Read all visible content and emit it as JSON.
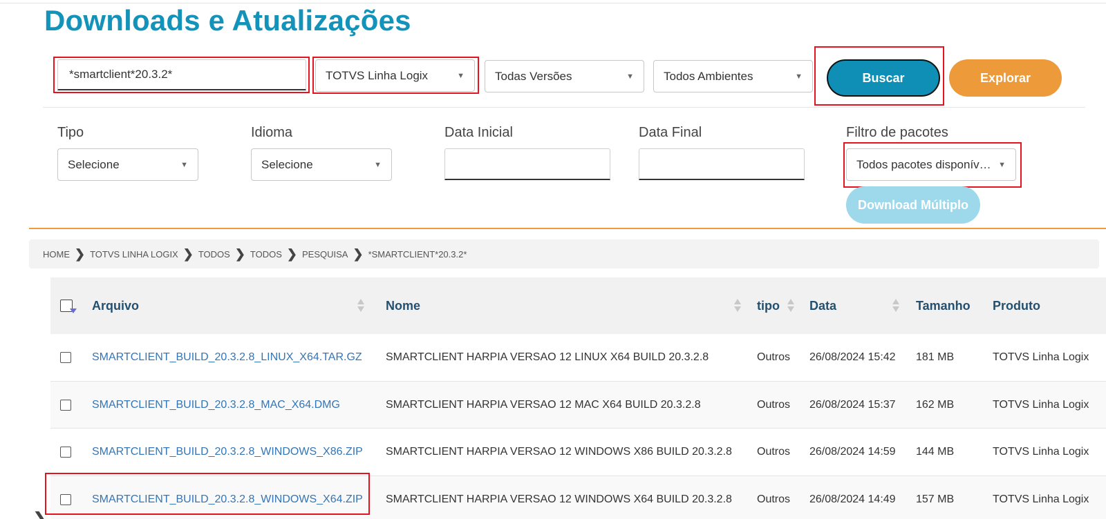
{
  "page_title": "Downloads e Atualizações",
  "search": {
    "query": "*smartclient*20.3.2*",
    "line": "TOTVS Linha Logix",
    "version": "Todas Versões",
    "environment": "Todos Ambientes",
    "buscar_label": "Buscar",
    "explorar_label": "Explorar"
  },
  "filters": {
    "tipo_label": "Tipo",
    "tipo_value": "Selecione",
    "idioma_label": "Idioma",
    "idioma_value": "Selecione",
    "data_inicial_label": "Data Inicial",
    "data_final_label": "Data Final",
    "pacotes_label": "Filtro de pacotes",
    "pacotes_value": "Todos pacotes disponíveis",
    "download_multiplo_label": "Download Múltiplo"
  },
  "breadcrumb": [
    "HOME",
    "TOTVS LINHA LOGIX",
    "TODOS",
    "TODOS",
    "PESQUISA",
    "*SMARTCLIENT*20.3.2*"
  ],
  "table": {
    "columns": [
      "Arquivo",
      "Nome",
      "tipo",
      "Data",
      "Tamanho",
      "Produto"
    ],
    "rows": [
      {
        "arquivo": "SMARTCLIENT_BUILD_20.3.2.8_LINUX_X64.TAR.GZ",
        "nome": "SMARTCLIENT HARPIA VERSAO 12 LINUX X64 BUILD 20.3.2.8",
        "tipo": "Outros",
        "data": "26/08/2024 15:42",
        "tamanho": "181 MB",
        "produto": "TOTVS Linha Logix"
      },
      {
        "arquivo": "SMARTCLIENT_BUILD_20.3.2.8_MAC_X64.DMG",
        "nome": "SMARTCLIENT HARPIA VERSAO 12 MAC X64 BUILD 20.3.2.8",
        "tipo": "Outros",
        "data": "26/08/2024 15:37",
        "tamanho": "162 MB",
        "produto": "TOTVS Linha Logix"
      },
      {
        "arquivo": "SMARTCLIENT_BUILD_20.3.2.8_WINDOWS_X86.ZIP",
        "nome": "SMARTCLIENT HARPIA VERSAO 12 WINDOWS X86 BUILD 20.3.2.8",
        "tipo": "Outros",
        "data": "26/08/2024 14:59",
        "tamanho": "144 MB",
        "produto": "TOTVS Linha Logix"
      },
      {
        "arquivo": "SMARTCLIENT_BUILD_20.3.2.8_WINDOWS_X64.ZIP",
        "nome": "SMARTCLIENT HARPIA VERSAO 12 WINDOWS X64 BUILD 20.3.2.8",
        "tipo": "Outros",
        "data": "26/08/2024 14:49",
        "tamanho": "157 MB",
        "produto": "TOTVS Linha Logix"
      }
    ]
  },
  "colors": {
    "title": "#1393b9",
    "buscar": "#0f8fb5",
    "explorar": "#ec9a3a",
    "download_multiplo": "#9dd8eb",
    "highlight": "#e3131f",
    "link": "#3375b6"
  },
  "icons": {
    "select_caret": "caret-down-icon",
    "breadcrumb_separator": "chevron-right-icon",
    "sort": "sort-icon"
  }
}
